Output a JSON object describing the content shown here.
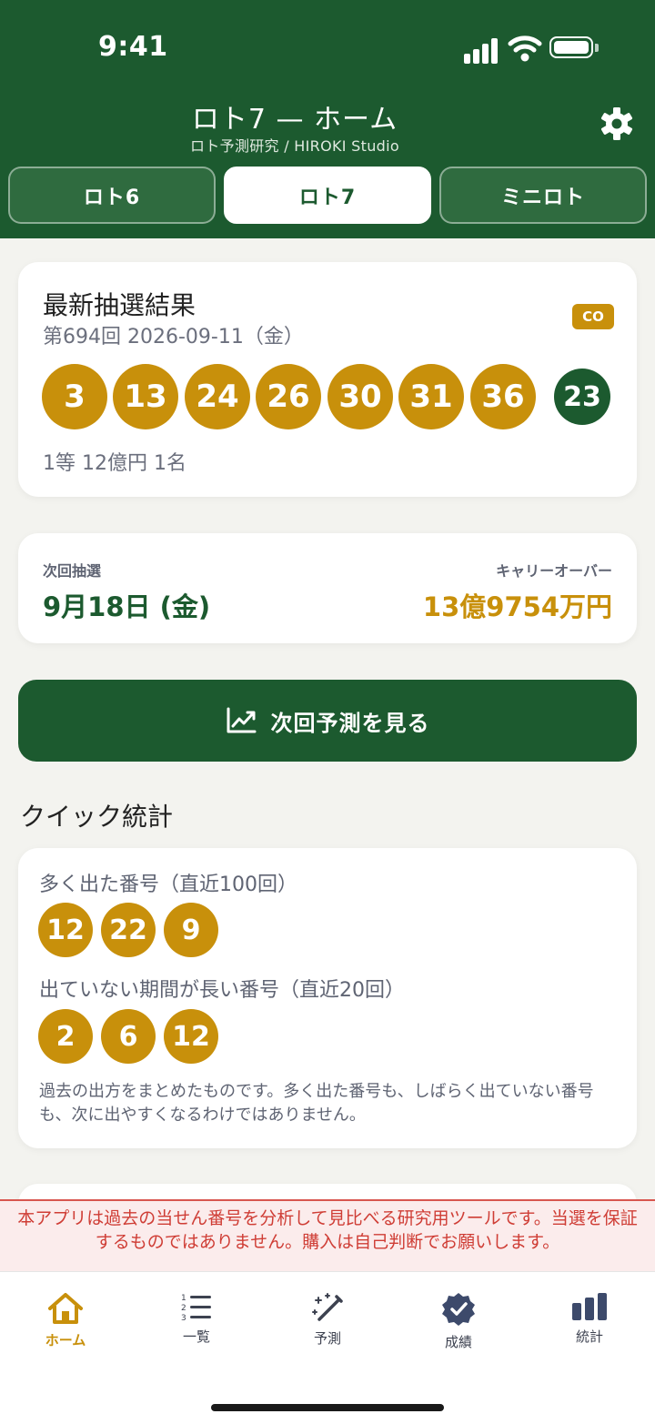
{
  "status": {
    "time": "9:41"
  },
  "header": {
    "title": "ロト7 — ホーム",
    "subtitle": "ロト予測研究 / HIROKI Studio",
    "settings_icon": "gear-icon",
    "background": "#1c5a2f"
  },
  "tabs": [
    {
      "label": "ロト6",
      "active": false
    },
    {
      "label": "ロト7",
      "active": true
    },
    {
      "label": "ミニロト",
      "active": false
    }
  ],
  "latest": {
    "title": "最新抽選結果",
    "round": "第694回  2026-09-11（金）",
    "badge": "CO",
    "numbers": [
      "3",
      "13",
      "24",
      "26",
      "30",
      "31",
      "36"
    ],
    "bonus": [
      "23"
    ],
    "prize": "1等 12億円  1名"
  },
  "next_draw": {
    "label": "次回抽選",
    "date": "9月18日 (金)",
    "carry_label": "キャリーオーバー",
    "carry_amount": "13億9754万円"
  },
  "predict_button": {
    "label": "次回予測を見る",
    "icon": "trend-chart-icon"
  },
  "quick_stats": {
    "title": "クイック統計",
    "hot_label": "多く出た番号（直近100回）",
    "hot_numbers": [
      "12",
      "22",
      "9"
    ],
    "cold_label": "出ていない期間が長い番号（直近20回）",
    "cold_numbers": [
      "2",
      "6",
      "12"
    ],
    "note": "過去の出方をまとめたものです。多く出た番号も、しばらく出ていない番号も、次に出やすくなるわけではありません。"
  },
  "disclaimer": "本アプリは過去の当せん番号を分析して見比べる研究用ツールです。当選を保証するものではありません。購入は自己判断でお願いします。",
  "nav": [
    {
      "label": "ホーム",
      "icon": "home-icon",
      "active": true
    },
    {
      "label": "一覧",
      "icon": "numbered-list-icon",
      "active": false
    },
    {
      "label": "予測",
      "icon": "magic-wand-icon",
      "active": false
    },
    {
      "label": "成績",
      "icon": "verified-badge-icon",
      "active": false
    },
    {
      "label": "統計",
      "icon": "bar-chart-icon",
      "active": false
    }
  ],
  "colors": {
    "primary": "#1c5a2f",
    "accent": "#c8900b",
    "warning": "#cf3d35"
  }
}
